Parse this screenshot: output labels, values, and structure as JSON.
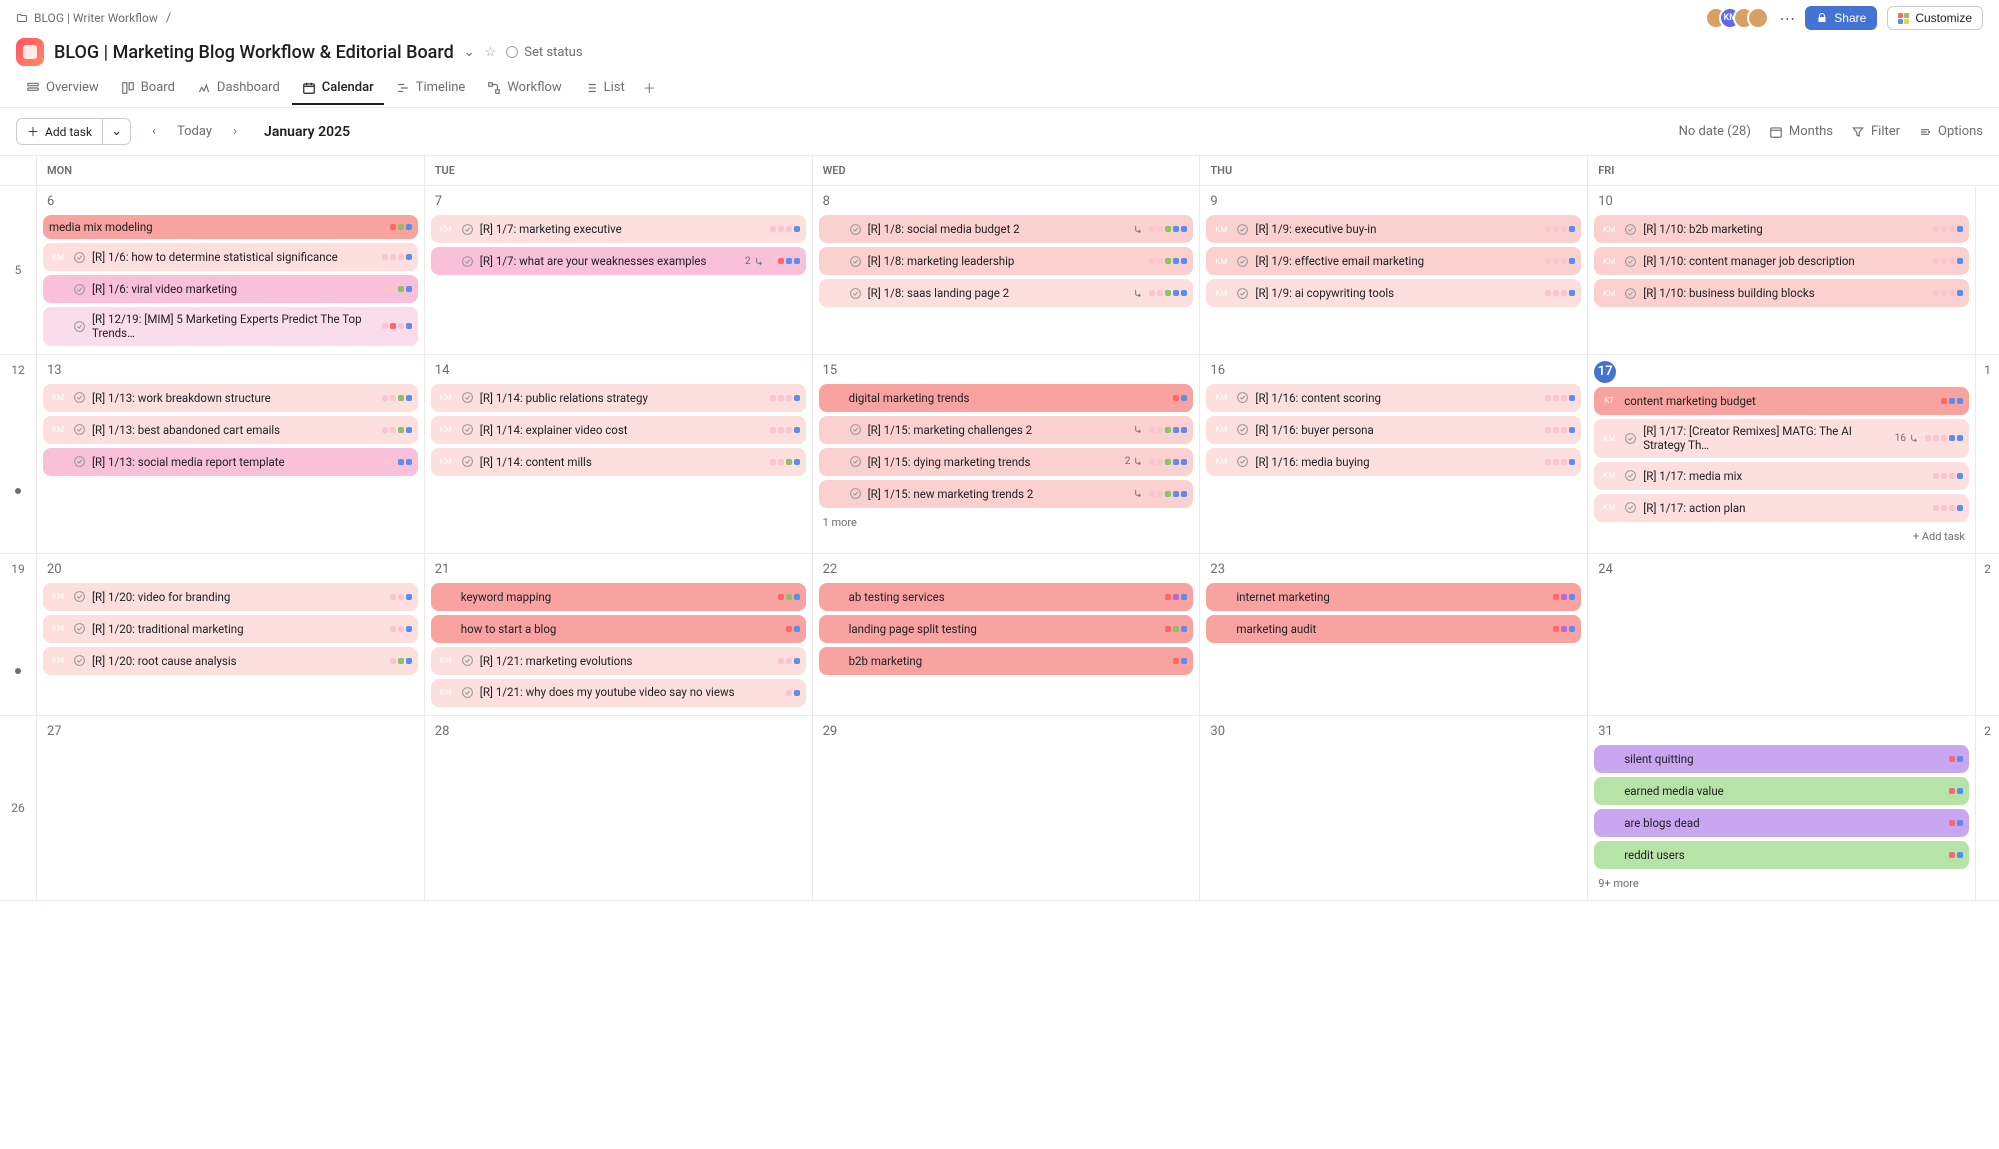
{
  "breadcrumb": {
    "folder": "BLOG | Writer Workflow",
    "sep": "/"
  },
  "header": {
    "title": "BLOG | Marketing Blog Workflow & Editorial Board",
    "set_status": "Set status",
    "share": "Share",
    "customize": "Customize"
  },
  "tabs": {
    "overview": "Overview",
    "board": "Board",
    "dashboard": "Dashboard",
    "calendar": "Calendar",
    "timeline": "Timeline",
    "workflow": "Workflow",
    "list": "List"
  },
  "toolbar": {
    "add_task": "Add task",
    "today": "Today",
    "month_label": "January 2025",
    "no_date": "No date (28)",
    "months": "Months",
    "filter": "Filter",
    "options": "Options"
  },
  "days_header": [
    "MON",
    "TUE",
    "WED",
    "THU",
    "FRI"
  ],
  "weeks": [
    {
      "wk": "5",
      "indicator": false,
      "days": {
        "mon": {
          "num": "6",
          "today": false,
          "tasks": [
            {
              "style": "red",
              "avatar": "",
              "title": "media mix modeling",
              "dots": [
                "#f66",
                "#8ec06c",
                "#5a8dee"
              ]
            },
            {
              "style": "red-dimmer",
              "avatar": "KM",
              "check": true,
              "title": "[R] 1/6: how to determine statistical significance",
              "wrap": true,
              "dots": [
                "#f9c6d0",
                "#f9c6d0",
                "#f9c6d0",
                "#5a8dee"
              ]
            },
            {
              "style": "pink",
              "avatar": "photo",
              "check": true,
              "title": "[R] 1/6: viral video marketing",
              "dots": [
                "#f9c6d0",
                "#f9c6d0",
                "#8ec06c",
                "#5a8dee"
              ]
            },
            {
              "style": "pink-dim",
              "avatar": "photo",
              "check": true,
              "title": "[R] 12/19: [MIM] 5 Marketing Experts Predict The Top Trends…",
              "wrap": true,
              "dots": [
                "#f9c6d0",
                "#f66",
                "#f9c6d0",
                "#5a8dee"
              ]
            }
          ]
        },
        "tue": {
          "num": "7",
          "today": false,
          "tasks": [
            {
              "style": "red-dimmer",
              "avatar": "KM",
              "check": true,
              "title": "[R] 1/7: marketing executive",
              "dots": [
                "#f9c6d0",
                "#f9c6d0",
                "#f9c6d0",
                "#5a8dee"
              ]
            },
            {
              "style": "pink",
              "avatar": "photo",
              "check": true,
              "title": "[R] 1/7: what are your weaknesses examples",
              "wrap": true,
              "sub": "2",
              "dots": [
                "#f9c6d0",
                "#f66",
                "#5a8dee",
                "#5a8dee"
              ]
            }
          ]
        },
        "wed": {
          "num": "8",
          "today": false,
          "tasks": [
            {
              "style": "red-dim",
              "avatar": "photo",
              "check": true,
              "title": "[R] 1/8: social media budget 2",
              "sub": "",
              "dots": [
                "#f9c6d0",
                "#f9c6d0",
                "#8ec06c",
                "#5a8dee",
                "#5a8dee"
              ]
            },
            {
              "style": "red-dim",
              "avatar": "photo",
              "check": true,
              "title": "[R] 1/8: marketing leadership",
              "dots": [
                "#f9c6d0",
                "#f9c6d0",
                "#8ec06c",
                "#5a8dee",
                "#5a8dee"
              ]
            },
            {
              "style": "red-dimmer",
              "avatar": "photo",
              "check": true,
              "title": "[R] 1/8: saas landing page 2",
              "sub": "",
              "dots": [
                "#f9c6d0",
                "#f9c6d0",
                "#8ec06c",
                "#5a8dee",
                "#5a8dee"
              ]
            }
          ]
        },
        "thu": {
          "num": "9",
          "today": false,
          "tasks": [
            {
              "style": "red-dim",
              "avatar": "KM",
              "check": true,
              "title": "[R] 1/9: executive buy-in",
              "dots": [
                "#f9c6d0",
                "#f9c6d0",
                "#f9c6d0",
                "#5a8dee"
              ]
            },
            {
              "style": "red-dim",
              "avatar": "KM",
              "check": true,
              "title": "[R] 1/9: effective email marketing",
              "dots": [
                "#f9c6d0",
                "#f9c6d0",
                "#f9c6d0",
                "#5a8dee"
              ]
            },
            {
              "style": "red-dimmer",
              "avatar": "KM",
              "check": true,
              "title": "[R] 1/9: ai copywriting tools",
              "dots": [
                "#f9c6d0",
                "#f9c6d0",
                "#f9c6d0",
                "#5a8dee"
              ]
            }
          ]
        },
        "fri": {
          "num": "10",
          "today": false,
          "tasks": [
            {
              "style": "red-dim",
              "avatar": "KM",
              "check": true,
              "title": "[R] 1/10: b2b marketing",
              "dots": [
                "#f9c6d0",
                "#f9c6d0",
                "#f9c6d0",
                "#5a8dee"
              ]
            },
            {
              "style": "red-dim",
              "avatar": "KM",
              "check": true,
              "title": "[R] 1/10: content manager job description",
              "wrap": true,
              "dots": [
                "#f9c6d0",
                "#f9c6d0",
                "#f9c6d0",
                "#5a8dee"
              ]
            },
            {
              "style": "red-dim",
              "avatar": "KM",
              "check": true,
              "title": "[R] 1/10: business building blocks",
              "dots": [
                "#f9c6d0",
                "#f9c6d0",
                "#f9c6d0",
                "#5a8dee"
              ]
            }
          ]
        }
      }
    },
    {
      "wk": "12",
      "indicator": true,
      "days": {
        "mon": {
          "num": "13",
          "tasks": [
            {
              "style": "red-dimmer",
              "avatar": "KM",
              "check": true,
              "title": "[R] 1/13: work breakdown structure",
              "dots": [
                "#f9c6d0",
                "#f9c6d0",
                "#8ec06c",
                "#5a8dee"
              ]
            },
            {
              "style": "red-dimmer",
              "avatar": "KM",
              "check": true,
              "title": "[R] 1/13: best abandoned cart emails",
              "wrap": true,
              "dots": [
                "#f9c6d0",
                "#f9c6d0",
                "#8ec06c",
                "#5a8dee"
              ]
            },
            {
              "style": "pink",
              "avatar": "photo",
              "check": true,
              "title": "[R] 1/13: social media report template",
              "wrap": true,
              "dots": [
                "#f9c6d0",
                "#f9c6d0",
                "#5a8dee",
                "#5a8dee"
              ]
            }
          ]
        },
        "tue": {
          "num": "14",
          "tasks": [
            {
              "style": "red-dimmer",
              "avatar": "KM",
              "check": true,
              "title": "[R] 1/14: public relations strategy",
              "dots": [
                "#f9c6d0",
                "#f9c6d0",
                "#f9c6d0",
                "#5a8dee"
              ]
            },
            {
              "style": "red-dimmer",
              "avatar": "KM",
              "check": true,
              "title": "[R] 1/14: explainer video cost",
              "dots": [
                "#f9c6d0",
                "#f9c6d0",
                "#f9c6d0",
                "#5a8dee"
              ]
            },
            {
              "style": "red-dimmer",
              "avatar": "KM",
              "check": true,
              "title": "[R] 1/14: content mills",
              "dots": [
                "#f9c6d0",
                "#f9c6d0",
                "#8ec06c",
                "#5a8dee"
              ]
            }
          ]
        },
        "wed": {
          "num": "15",
          "tasks": [
            {
              "style": "red",
              "avatar": "photo",
              "title": "digital marketing trends",
              "dots": [
                "#f66",
                "#5a8dee"
              ]
            },
            {
              "style": "red-dim",
              "avatar": "photo",
              "check": true,
              "title": "[R] 1/15: marketing challenges 2",
              "sub": "",
              "dots": [
                "#f9c6d0",
                "#f9c6d0",
                "#8ec06c",
                "#5a8dee",
                "#5a8dee"
              ]
            },
            {
              "style": "red-dim",
              "avatar": "photo",
              "check": true,
              "title": "[R] 1/15: dying marketing trends",
              "wrap": true,
              "sub": "2",
              "dots": [
                "#f9c6d0",
                "#f9c6d0",
                "#8ec06c",
                "#5a8dee",
                "#5a8dee"
              ]
            },
            {
              "style": "red-dim",
              "avatar": "photo",
              "check": true,
              "title": "[R] 1/15: new marketing trends 2",
              "sub": "",
              "dots": [
                "#f9c6d0",
                "#f9c6d0",
                "#8ec06c",
                "#5a8dee",
                "#5a8dee"
              ]
            }
          ],
          "more": "1 more"
        },
        "thu": {
          "num": "16",
          "tasks": [
            {
              "style": "red-dimmer",
              "avatar": "KM",
              "check": true,
              "title": "[R] 1/16: content scoring",
              "dots": [
                "#f9c6d0",
                "#f9c6d0",
                "#f9c6d0",
                "#5a8dee"
              ]
            },
            {
              "style": "red-dimmer",
              "avatar": "KM",
              "check": true,
              "title": "[R] 1/16: buyer persona",
              "dots": [
                "#f9c6d0",
                "#f9c6d0",
                "#f9c6d0",
                "#5a8dee"
              ]
            },
            {
              "style": "red-dimmer",
              "avatar": "KM",
              "check": true,
              "title": "[R] 1/16: media buying",
              "dots": [
                "#f9c6d0",
                "#f9c6d0",
                "#f9c6d0",
                "#5a8dee"
              ]
            }
          ]
        },
        "fri": {
          "num": "17",
          "today": true,
          "tasks": [
            {
              "style": "red",
              "avatar": "KT",
              "title": "content marketing budget",
              "dots": [
                "#f66",
                "#5a8dee",
                "#5a8dee"
              ]
            },
            {
              "style": "red-dimmer",
              "avatar": "KM",
              "check": true,
              "title": "[R] 1/17: [Creator Remixes] MATG: The AI Strategy Th…",
              "wrap": true,
              "sub": "16",
              "dots": [
                "#f9c6d0",
                "#f9c6d0",
                "#f9c6d0",
                "#5a8dee",
                "#5a8dee"
              ]
            },
            {
              "style": "red-dimmer",
              "avatar": "KM",
              "check": true,
              "title": "[R] 1/17: media mix",
              "dots": [
                "#f9c6d0",
                "#f9c6d0",
                "#f9c6d0",
                "#5a8dee"
              ]
            },
            {
              "style": "red-dimmer",
              "avatar": "KM",
              "check": true,
              "title": "[R] 1/17: action plan",
              "dots": [
                "#f9c6d0",
                "#f9c6d0",
                "#f9c6d0",
                "#5a8dee"
              ]
            }
          ],
          "add_task": "+ Add task"
        }
      }
    },
    {
      "wk": "19",
      "indicator": true,
      "days": {
        "mon": {
          "num": "20",
          "tasks": [
            {
              "style": "red-dimmer",
              "avatar": "KM",
              "check": true,
              "title": "[R] 1/20: video for branding",
              "dots": [
                "#f9c6d0",
                "#f9c6d0",
                "#5a8dee"
              ]
            },
            {
              "style": "red-dimmer",
              "avatar": "KM",
              "check": true,
              "title": "[R] 1/20: traditional marketing",
              "dots": [
                "#f9c6d0",
                "#f9c6d0",
                "#5a8dee"
              ]
            },
            {
              "style": "red-dimmer",
              "avatar": "KM",
              "check": true,
              "title": "[R] 1/20: root cause analysis",
              "dots": [
                "#f9c6d0",
                "#8ec06c",
                "#5a8dee"
              ]
            }
          ]
        },
        "tue": {
          "num": "21",
          "tasks": [
            {
              "style": "red",
              "avatar": "photo",
              "title": "keyword mapping",
              "dots": [
                "#f66",
                "#8ec06c",
                "#5a8dee"
              ]
            },
            {
              "style": "red",
              "avatar": "photo",
              "title": "how to start a blog",
              "dots": [
                "#f66",
                "#5a8dee"
              ]
            },
            {
              "style": "red-dimmer",
              "avatar": "KM",
              "check": true,
              "title": "[R] 1/21: marketing evolutions",
              "dots": [
                "#f9c6d0",
                "#f9c6d0",
                "#5a8dee"
              ]
            },
            {
              "style": "red-dimmer",
              "avatar": "KM",
              "check": true,
              "title": "[R] 1/21: why does my youtube video say no views",
              "wrap": true,
              "dots": [
                "#f9c6d0",
                "#5a8dee"
              ]
            }
          ]
        },
        "wed": {
          "num": "22",
          "tasks": [
            {
              "style": "red",
              "avatar": "photo",
              "title": "ab testing services",
              "dots": [
                "#f66",
                "#b36bd4",
                "#5a8dee"
              ]
            },
            {
              "style": "red",
              "avatar": "photo",
              "title": "landing page split testing",
              "dots": [
                "#f66",
                "#8ec06c",
                "#5a8dee"
              ]
            },
            {
              "style": "red",
              "avatar": "photo",
              "title": "b2b marketing",
              "dots": [
                "#f66",
                "#5a8dee"
              ]
            }
          ]
        },
        "thu": {
          "num": "23",
          "tasks": [
            {
              "style": "red",
              "avatar": "photo",
              "title": "internet marketing",
              "dots": [
                "#f66",
                "#b36bd4",
                "#5a8dee"
              ]
            },
            {
              "style": "red",
              "avatar": "photo",
              "title": "marketing audit",
              "dots": [
                "#f66",
                "#b36bd4",
                "#5a8dee"
              ]
            }
          ]
        },
        "fri": {
          "num": "24",
          "tasks": []
        }
      },
      "edge": "2"
    },
    {
      "wk": "26",
      "indicator": false,
      "days": {
        "mon": {
          "num": "27",
          "tasks": []
        },
        "tue": {
          "num": "28",
          "tasks": []
        },
        "wed": {
          "num": "29",
          "tasks": []
        },
        "thu": {
          "num": "30",
          "tasks": []
        },
        "fri": {
          "num": "31",
          "tasks": [
            {
              "style": "purple",
              "avatar": "photo",
              "title": "silent quitting",
              "dots": [
                "#f66",
                "#5a8dee"
              ]
            },
            {
              "style": "green",
              "avatar": "photo",
              "title": "earned media value",
              "dots": [
                "#f66",
                "#5a8dee"
              ]
            },
            {
              "style": "purple",
              "avatar": "photo",
              "title": "are blogs dead",
              "dots": [
                "#f66",
                "#5a8dee"
              ]
            },
            {
              "style": "green",
              "avatar": "photo",
              "title": "reddit users",
              "dots": [
                "#f66",
                "#5a8dee"
              ]
            }
          ],
          "more": "9+ more"
        }
      },
      "edge": "2"
    }
  ],
  "edges": {
    "w1": "1",
    "w2": "1"
  }
}
